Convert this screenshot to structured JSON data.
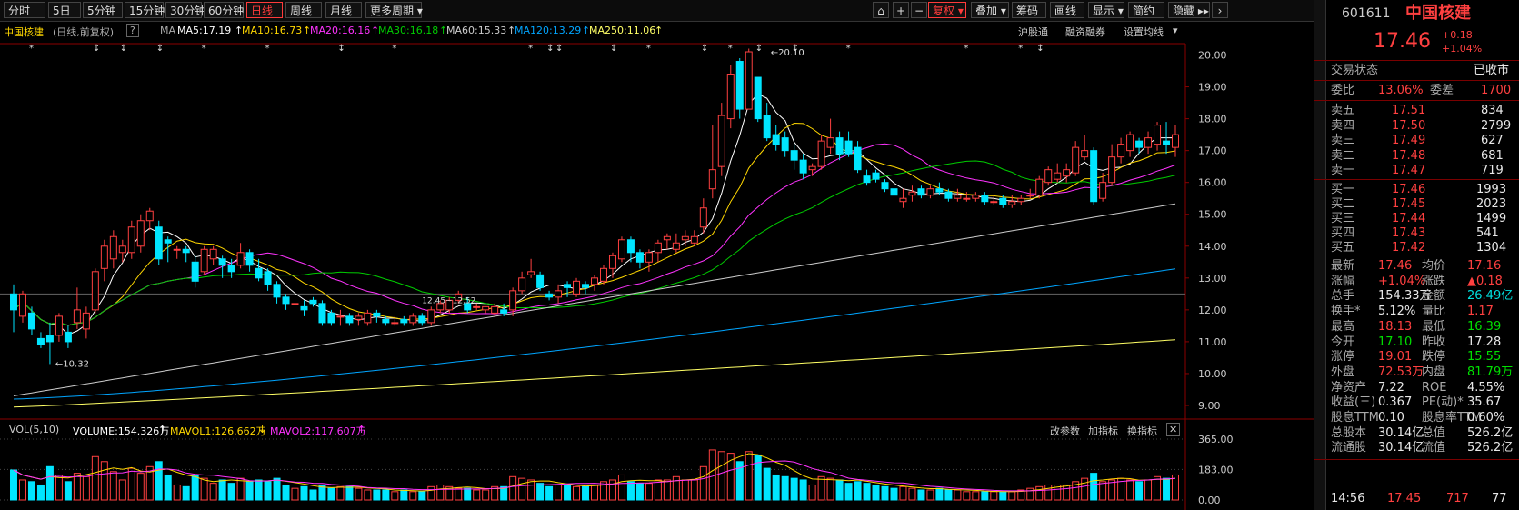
{
  "toolbar": {
    "periods": [
      "分时",
      "5日",
      "5分钟",
      "15分钟",
      "30分钟",
      "60分钟",
      "日线",
      "周线",
      "月线",
      "更多周期"
    ],
    "active_period": "日线",
    "right_buttons": [
      "复权",
      "叠加",
      "筹码",
      "画线",
      "显示",
      "简约",
      "隐藏"
    ]
  },
  "chart_header": {
    "stock_name": "中国核建",
    "adjust_label": "(日线,前复权)",
    "question": "?",
    "ma_label": "MA",
    "ma5": "MA5:17.19",
    "ma10": "MA10:16.73",
    "ma20": "MA20:16.16",
    "ma30": "MA30:16.18",
    "ma60": "MA60:15.33",
    "ma120": "MA120:13.29",
    "ma250": "MA250:11.06",
    "right_links": [
      "沪股通",
      "融资融券",
      "设置均线"
    ]
  },
  "volume_header": {
    "label": "VOL(5,10)",
    "volume": "VOLUME:154.326万",
    "mavol1": "MAVOL1:126.662万",
    "mavol2": "MAVOL2:117.607万",
    "right_links": [
      "改参数",
      "加指标",
      "换指标"
    ],
    "close": "✕"
  },
  "annotations": {
    "high_label": "20.10",
    "low_label": "10.32",
    "mid_label": "12.45~12.52"
  },
  "colors": {
    "up": "#ff4040",
    "down": "#00e5ff",
    "ma5": "#ffffff",
    "ma10": "#ffd700",
    "ma20": "#ff33ff",
    "ma30": "#00cc00",
    "ma60": "#cccccc",
    "ma120": "#00a5ff",
    "ma250": "#ffff66"
  },
  "chart_data": {
    "type": "candlestick",
    "y_ticks": [
      "20.00",
      "19.00",
      "18.00",
      "17.00",
      "16.00",
      "15.00",
      "14.00",
      "13.00",
      "12.00",
      "11.00",
      "10.00",
      "9.00"
    ],
    "ylim": [
      8.8,
      20.3
    ],
    "vol_ticks": [
      "365.00",
      "183.00",
      "0.00"
    ],
    "vol_max": 365,
    "candles": [
      [
        12.5,
        12.0,
        12.8,
        11.3,
        180
      ],
      [
        11.8,
        12.5,
        12.6,
        11.6,
        120
      ],
      [
        11.9,
        11.4,
        12.1,
        11.2,
        110
      ],
      [
        11.1,
        10.9,
        11.3,
        10.8,
        90
      ],
      [
        11.2,
        11.0,
        11.6,
        10.3,
        200
      ],
      [
        11.2,
        11.8,
        11.9,
        11.0,
        150
      ],
      [
        11.3,
        11.0,
        11.5,
        10.8,
        110
      ],
      [
        11.6,
        12.0,
        12.7,
        11.4,
        160
      ],
      [
        11.4,
        11.9,
        12.1,
        11.1,
        140
      ],
      [
        12.0,
        13.2,
        13.3,
        11.9,
        260
      ],
      [
        13.3,
        14.0,
        14.2,
        12.9,
        230
      ],
      [
        13.6,
        14.3,
        14.5,
        13.3,
        170
      ],
      [
        13.8,
        14.0,
        14.2,
        13.5,
        120
      ],
      [
        13.8,
        14.6,
        14.8,
        13.6,
        190
      ],
      [
        14.0,
        14.8,
        15.0,
        13.8,
        160
      ],
      [
        14.8,
        15.1,
        15.2,
        14.5,
        200
      ],
      [
        14.6,
        13.6,
        14.8,
        13.4,
        230
      ],
      [
        14.2,
        14.1,
        14.3,
        13.5,
        150
      ],
      [
        13.9,
        13.9,
        14.0,
        13.6,
        90
      ],
      [
        13.9,
        13.8,
        14.0,
        13.5,
        80
      ],
      [
        13.5,
        12.9,
        13.7,
        12.7,
        150
      ],
      [
        13.2,
        13.9,
        14.0,
        13.1,
        130
      ],
      [
        13.6,
        13.9,
        14.0,
        13.4,
        100
      ],
      [
        13.6,
        13.4,
        13.7,
        13.0,
        120
      ],
      [
        13.4,
        13.2,
        13.6,
        13.0,
        100
      ],
      [
        13.4,
        13.8,
        14.1,
        13.3,
        130
      ],
      [
        13.8,
        13.4,
        13.9,
        13.2,
        110
      ],
      [
        13.3,
        13.0,
        13.6,
        12.9,
        120
      ],
      [
        13.2,
        12.8,
        13.3,
        12.6,
        110
      ],
      [
        12.8,
        12.4,
        12.9,
        12.2,
        130
      ],
      [
        12.4,
        12.2,
        12.5,
        12.0,
        90
      ],
      [
        12.2,
        12.2,
        12.4,
        12.0,
        70
      ],
      [
        12.1,
        12.0,
        12.3,
        11.8,
        80
      ],
      [
        12.3,
        12.2,
        12.4,
        12.1,
        60
      ],
      [
        12.2,
        11.6,
        12.3,
        11.5,
        90
      ],
      [
        11.9,
        11.6,
        12.0,
        11.5,
        70
      ],
      [
        11.8,
        11.8,
        12.0,
        11.5,
        80
      ],
      [
        11.8,
        11.6,
        11.9,
        11.5,
        80
      ],
      [
        11.7,
        11.8,
        11.9,
        11.5,
        70
      ],
      [
        11.6,
        11.9,
        12.0,
        11.5,
        60
      ],
      [
        11.9,
        11.8,
        12.0,
        11.6,
        60
      ],
      [
        11.7,
        11.6,
        11.8,
        11.5,
        60
      ],
      [
        11.6,
        11.6,
        11.8,
        11.5,
        50
      ],
      [
        11.7,
        11.6,
        11.8,
        11.5,
        60
      ],
      [
        11.6,
        11.8,
        11.9,
        11.5,
        50
      ],
      [
        11.8,
        11.6,
        11.9,
        11.5,
        50
      ],
      [
        11.6,
        12.0,
        12.1,
        11.5,
        80
      ],
      [
        12.0,
        12.2,
        12.3,
        11.9,
        90
      ],
      [
        12.0,
        12.3,
        12.4,
        11.9,
        80
      ],
      [
        12.3,
        12.5,
        12.6,
        12.2,
        70
      ],
      [
        12.2,
        12.0,
        12.4,
        11.9,
        70
      ],
      [
        12.1,
        12.1,
        12.2,
        12.0,
        60
      ],
      [
        12.0,
        12.1,
        12.1,
        11.9,
        60
      ],
      [
        11.9,
        12.1,
        12.2,
        11.8,
        80
      ],
      [
        12.0,
        11.9,
        12.2,
        11.8,
        80
      ],
      [
        12.0,
        12.6,
        12.7,
        11.8,
        140
      ],
      [
        12.6,
        13.0,
        13.2,
        12.5,
        130
      ],
      [
        13.1,
        13.2,
        13.6,
        13.0,
        120
      ],
      [
        13.1,
        12.7,
        13.2,
        12.6,
        100
      ],
      [
        12.5,
        12.4,
        12.6,
        12.3,
        80
      ],
      [
        12.4,
        12.6,
        12.8,
        12.2,
        90
      ],
      [
        12.8,
        12.7,
        12.9,
        12.4,
        90
      ],
      [
        12.5,
        12.9,
        13.0,
        12.4,
        80
      ],
      [
        12.8,
        12.7,
        12.9,
        12.5,
        80
      ],
      [
        12.8,
        13.0,
        13.1,
        12.6,
        90
      ],
      [
        12.9,
        13.3,
        13.4,
        12.8,
        110
      ],
      [
        13.3,
        13.7,
        13.8,
        13.0,
        120
      ],
      [
        13.6,
        14.2,
        14.3,
        13.5,
        150
      ],
      [
        14.2,
        13.8,
        14.3,
        13.5,
        110
      ],
      [
        13.8,
        13.5,
        13.9,
        13.3,
        100
      ],
      [
        13.5,
        13.8,
        13.9,
        13.2,
        100
      ],
      [
        13.8,
        14.1,
        14.2,
        13.5,
        120
      ],
      [
        14.2,
        14.3,
        14.4,
        13.9,
        120
      ],
      [
        13.9,
        14.1,
        14.4,
        13.8,
        140
      ],
      [
        14.2,
        14.3,
        14.5,
        14.0,
        120
      ],
      [
        14.1,
        14.3,
        14.5,
        14.0,
        120
      ],
      [
        14.6,
        15.2,
        15.5,
        14.4,
        200
      ],
      [
        15.8,
        16.4,
        17.8,
        15.5,
        300
      ],
      [
        16.5,
        18.1,
        18.5,
        16.2,
        290
      ],
      [
        18.0,
        19.4,
        19.7,
        17.7,
        280
      ],
      [
        19.8,
        18.3,
        19.9,
        18.0,
        230
      ],
      [
        18.3,
        20.1,
        20.2,
        18.3,
        290
      ],
      [
        19.3,
        18.0,
        19.2,
        17.9,
        270
      ],
      [
        18.1,
        17.4,
        18.5,
        17.3,
        190
      ],
      [
        17.5,
        17.2,
        17.8,
        17.0,
        150
      ],
      [
        17.4,
        17.0,
        17.6,
        16.8,
        140
      ],
      [
        17.0,
        16.7,
        17.2,
        16.4,
        130
      ],
      [
        16.7,
        16.3,
        16.9,
        16.1,
        120
      ],
      [
        16.4,
        16.5,
        16.6,
        16.2,
        90
      ],
      [
        16.5,
        17.3,
        17.5,
        16.4,
        140
      ],
      [
        17.1,
        17.4,
        18.0,
        16.9,
        130
      ],
      [
        17.4,
        16.9,
        17.6,
        16.7,
        120
      ],
      [
        17.3,
        16.9,
        17.6,
        16.8,
        100
      ],
      [
        17.1,
        16.4,
        17.3,
        16.3,
        110
      ],
      [
        16.2,
        16.0,
        16.4,
        15.9,
        100
      ],
      [
        16.3,
        16.1,
        16.4,
        16.0,
        90
      ],
      [
        16.0,
        15.8,
        16.1,
        15.7,
        80
      ],
      [
        15.8,
        15.6,
        15.9,
        15.5,
        70
      ],
      [
        15.4,
        15.5,
        15.8,
        15.2,
        80
      ],
      [
        15.6,
        15.7,
        15.9,
        15.4,
        70
      ],
      [
        15.8,
        15.6,
        15.9,
        15.5,
        60
      ],
      [
        15.6,
        15.8,
        15.9,
        15.5,
        60
      ],
      [
        15.8,
        15.7,
        16.0,
        15.6,
        70
      ],
      [
        15.7,
        15.5,
        15.8,
        15.4,
        60
      ],
      [
        15.5,
        15.6,
        15.8,
        15.4,
        60
      ],
      [
        15.5,
        15.5,
        15.7,
        15.4,
        50
      ],
      [
        15.5,
        15.6,
        15.7,
        15.4,
        50
      ],
      [
        15.6,
        15.4,
        15.7,
        15.3,
        50
      ],
      [
        15.4,
        15.4,
        15.6,
        15.3,
        50
      ],
      [
        15.5,
        15.3,
        15.6,
        15.2,
        50
      ],
      [
        15.3,
        15.4,
        15.6,
        15.2,
        50
      ],
      [
        15.4,
        15.5,
        15.6,
        15.3,
        60
      ],
      [
        15.6,
        15.6,
        15.8,
        15.5,
        70
      ],
      [
        15.6,
        16.1,
        16.2,
        15.5,
        80
      ],
      [
        16.0,
        16.4,
        16.5,
        15.9,
        90
      ],
      [
        16.1,
        16.3,
        16.6,
        16.0,
        90
      ],
      [
        16.2,
        16.4,
        16.6,
        16.0,
        90
      ],
      [
        16.3,
        17.1,
        17.3,
        16.2,
        110
      ],
      [
        16.8,
        17.0,
        17.5,
        16.7,
        130
      ],
      [
        17.0,
        15.4,
        17.1,
        15.3,
        160
      ],
      [
        15.5,
        16.0,
        16.3,
        15.4,
        110
      ],
      [
        16.0,
        16.8,
        17.2,
        15.9,
        120
      ],
      [
        16.8,
        17.2,
        17.4,
        16.6,
        130
      ],
      [
        17.0,
        17.5,
        17.6,
        16.8,
        120
      ],
      [
        17.3,
        17.1,
        17.4,
        16.9,
        110
      ],
      [
        17.1,
        17.4,
        17.6,
        16.9,
        120
      ],
      [
        17.2,
        17.8,
        17.9,
        17.0,
        140
      ],
      [
        17.3,
        17.2,
        17.9,
        16.9,
        130
      ],
      [
        17.1,
        17.5,
        17.8,
        16.8,
        150
      ]
    ]
  },
  "quote": {
    "code": "601611",
    "name": "中国核建",
    "price": "17.46",
    "change": "+0.18",
    "change_pct": "+1.04%",
    "status_label": "交易状态",
    "status_value": "已收市",
    "weibi_label": "委比",
    "weibi_value": "13.06%",
    "weicha_label": "委差",
    "weicha_value": "1700",
    "asks": [
      {
        "label": "卖五",
        "price": "17.51",
        "vol": "834"
      },
      {
        "label": "卖四",
        "price": "17.50",
        "vol": "2799"
      },
      {
        "label": "卖三",
        "price": "17.49",
        "vol": "627"
      },
      {
        "label": "卖二",
        "price": "17.48",
        "vol": "681"
      },
      {
        "label": "卖一",
        "price": "17.47",
        "vol": "719"
      }
    ],
    "bids": [
      {
        "label": "买一",
        "price": "17.46",
        "vol": "1993"
      },
      {
        "label": "买二",
        "price": "17.45",
        "vol": "2023"
      },
      {
        "label": "买三",
        "price": "17.44",
        "vol": "1499"
      },
      {
        "label": "买四",
        "price": "17.43",
        "vol": "541"
      },
      {
        "label": "买五",
        "price": "17.42",
        "vol": "1304"
      }
    ],
    "stats": [
      {
        "l1": "最新",
        "v1": "17.46",
        "c1": "red",
        "l2": "均价",
        "v2": "17.16",
        "c2": "red"
      },
      {
        "l1": "涨幅",
        "v1": "+1.04%",
        "c1": "red",
        "l2": "涨跌",
        "v2": "▲0.18",
        "c2": "red"
      },
      {
        "l1": "总手",
        "v1": "154.33万",
        "c1": "white",
        "l2": "金额",
        "v2": "26.49亿",
        "c2": "cyan"
      },
      {
        "l1": "换手*",
        "v1": "5.12%",
        "c1": "white",
        "l2": "量比",
        "v2": "1.17",
        "c2": "red"
      },
      {
        "l1": "最高",
        "v1": "18.13",
        "c1": "red",
        "l2": "最低",
        "v2": "16.39",
        "c2": "green"
      },
      {
        "l1": "今开",
        "v1": "17.10",
        "c1": "green",
        "l2": "昨收",
        "v2": "17.28",
        "c2": "white"
      },
      {
        "l1": "涨停",
        "v1": "19.01",
        "c1": "red",
        "l2": "跌停",
        "v2": "15.55",
        "c2": "green"
      },
      {
        "l1": "外盘",
        "v1": "72.53万",
        "c1": "red",
        "l2": "内盘",
        "v2": "81.79万",
        "c2": "green"
      },
      {
        "l1": "净资产",
        "v1": "7.22",
        "c1": "white",
        "l2": "ROE",
        "v2": "4.55%",
        "c2": "white"
      },
      {
        "l1": "收益(三)",
        "v1": "0.367",
        "c1": "white",
        "l2": "PE(动)*",
        "v2": "35.67",
        "c2": "white"
      },
      {
        "l1": "股息TTM",
        "v1": "0.10",
        "c1": "white",
        "l2": "股息率TTM",
        "v2": "0.60%",
        "c2": "white"
      },
      {
        "l1": "总股本",
        "v1": "30.14亿",
        "c1": "white",
        "l2": "总值",
        "v2": "526.2亿",
        "c2": "white"
      },
      {
        "l1": "流通股",
        "v1": "30.14亿",
        "c1": "white",
        "l2": "流值",
        "v2": "526.2亿",
        "c2": "white"
      }
    ],
    "tick": {
      "time": "14:56",
      "price": "17.45",
      "vol": "717",
      "num": "77"
    }
  }
}
